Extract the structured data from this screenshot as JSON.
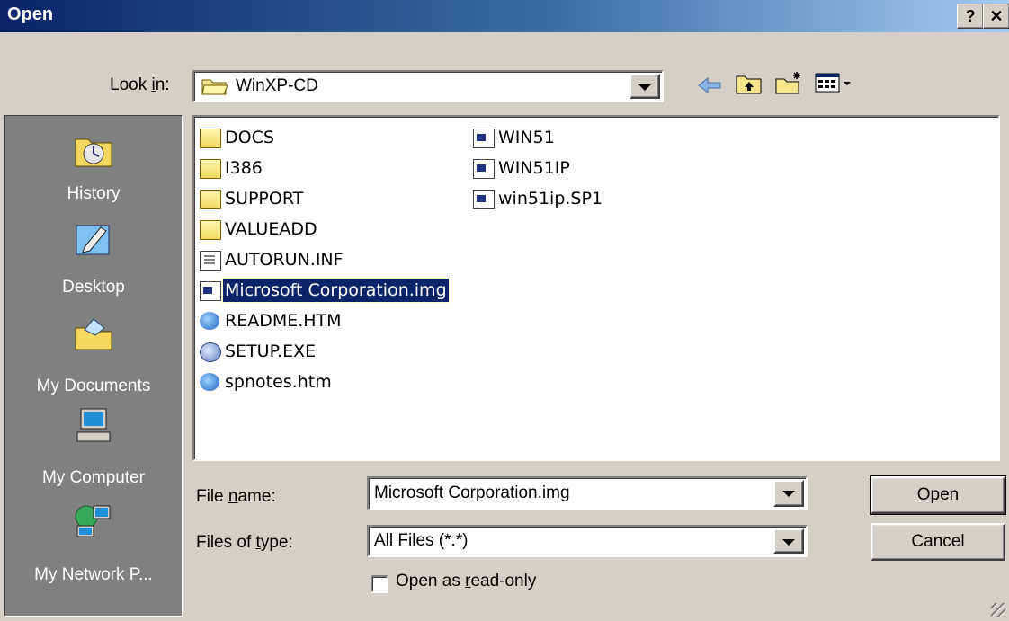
{
  "window": {
    "title": "Open",
    "help_btn": "?",
    "close_btn": "✕"
  },
  "look_in": {
    "label_pre": "Look ",
    "label_key": "i",
    "label_post": "n:",
    "value": "WinXP-CD"
  },
  "toolbar": {
    "back_icon": "back-arrow-icon",
    "up_icon": "up-folder-icon",
    "new_folder_icon": "new-folder-icon",
    "view_icon": "view-menu-icon"
  },
  "places": [
    {
      "label": "History",
      "icon": "history-icon"
    },
    {
      "label": "Desktop",
      "icon": "desktop-icon"
    },
    {
      "label": "My Documents",
      "icon": "my-documents-icon"
    },
    {
      "label": "My Computer",
      "icon": "my-computer-icon"
    },
    {
      "label": "My Network P...",
      "icon": "network-places-icon"
    }
  ],
  "files": {
    "col1": [
      {
        "name": "DOCS",
        "type": "folder"
      },
      {
        "name": "I386",
        "type": "folder"
      },
      {
        "name": "SUPPORT",
        "type": "folder"
      },
      {
        "name": "VALUEADD",
        "type": "folder"
      },
      {
        "name": "AUTORUN.INF",
        "type": "inf"
      },
      {
        "name": "Microsoft Corporation.img",
        "type": "img",
        "selected": true
      },
      {
        "name": "README.HTM",
        "type": "htm"
      },
      {
        "name": "SETUP.EXE",
        "type": "exe"
      },
      {
        "name": "spnotes.htm",
        "type": "htm"
      }
    ],
    "col2": [
      {
        "name": "WIN51",
        "type": "img"
      },
      {
        "name": "WIN51IP",
        "type": "img"
      },
      {
        "name": "win51ip.SP1",
        "type": "img"
      }
    ]
  },
  "file_name": {
    "label_pre": "File ",
    "label_key": "n",
    "label_post": "ame:",
    "value": "Microsoft Corporation.img"
  },
  "file_type": {
    "label_pre": "Files of ",
    "label_key": "t",
    "label_post": "ype:",
    "value": "All Files (*.*)"
  },
  "read_only": {
    "label_pre": "Open as ",
    "label_key": "r",
    "label_post": "ead-only",
    "checked": false
  },
  "buttons": {
    "open_key": "O",
    "open_rest": "pen",
    "cancel": "Cancel"
  }
}
